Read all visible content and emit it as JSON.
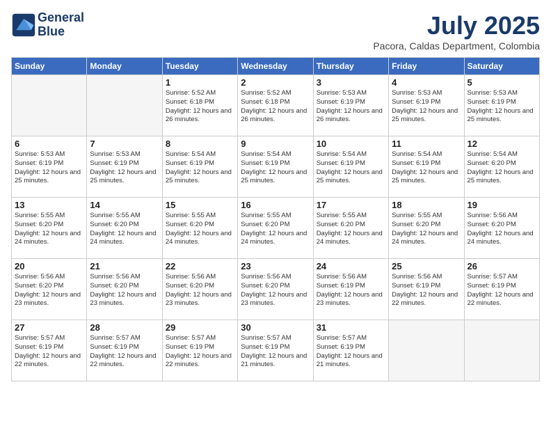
{
  "header": {
    "logo_line1": "General",
    "logo_line2": "Blue",
    "month": "July 2025",
    "location": "Pacora, Caldas Department, Colombia"
  },
  "days_of_week": [
    "Sunday",
    "Monday",
    "Tuesday",
    "Wednesday",
    "Thursday",
    "Friday",
    "Saturday"
  ],
  "weeks": [
    [
      {
        "day": "",
        "info": ""
      },
      {
        "day": "",
        "info": ""
      },
      {
        "day": "1",
        "info": "Sunrise: 5:52 AM\nSunset: 6:18 PM\nDaylight: 12 hours and 26 minutes."
      },
      {
        "day": "2",
        "info": "Sunrise: 5:52 AM\nSunset: 6:18 PM\nDaylight: 12 hours and 26 minutes."
      },
      {
        "day": "3",
        "info": "Sunrise: 5:53 AM\nSunset: 6:19 PM\nDaylight: 12 hours and 26 minutes."
      },
      {
        "day": "4",
        "info": "Sunrise: 5:53 AM\nSunset: 6:19 PM\nDaylight: 12 hours and 25 minutes."
      },
      {
        "day": "5",
        "info": "Sunrise: 5:53 AM\nSunset: 6:19 PM\nDaylight: 12 hours and 25 minutes."
      }
    ],
    [
      {
        "day": "6",
        "info": "Sunrise: 5:53 AM\nSunset: 6:19 PM\nDaylight: 12 hours and 25 minutes."
      },
      {
        "day": "7",
        "info": "Sunrise: 5:53 AM\nSunset: 6:19 PM\nDaylight: 12 hours and 25 minutes."
      },
      {
        "day": "8",
        "info": "Sunrise: 5:54 AM\nSunset: 6:19 PM\nDaylight: 12 hours and 25 minutes."
      },
      {
        "day": "9",
        "info": "Sunrise: 5:54 AM\nSunset: 6:19 PM\nDaylight: 12 hours and 25 minutes."
      },
      {
        "day": "10",
        "info": "Sunrise: 5:54 AM\nSunset: 6:19 PM\nDaylight: 12 hours and 25 minutes."
      },
      {
        "day": "11",
        "info": "Sunrise: 5:54 AM\nSunset: 6:19 PM\nDaylight: 12 hours and 25 minutes."
      },
      {
        "day": "12",
        "info": "Sunrise: 5:54 AM\nSunset: 6:20 PM\nDaylight: 12 hours and 25 minutes."
      }
    ],
    [
      {
        "day": "13",
        "info": "Sunrise: 5:55 AM\nSunset: 6:20 PM\nDaylight: 12 hours and 24 minutes."
      },
      {
        "day": "14",
        "info": "Sunrise: 5:55 AM\nSunset: 6:20 PM\nDaylight: 12 hours and 24 minutes."
      },
      {
        "day": "15",
        "info": "Sunrise: 5:55 AM\nSunset: 6:20 PM\nDaylight: 12 hours and 24 minutes."
      },
      {
        "day": "16",
        "info": "Sunrise: 5:55 AM\nSunset: 6:20 PM\nDaylight: 12 hours and 24 minutes."
      },
      {
        "day": "17",
        "info": "Sunrise: 5:55 AM\nSunset: 6:20 PM\nDaylight: 12 hours and 24 minutes."
      },
      {
        "day": "18",
        "info": "Sunrise: 5:55 AM\nSunset: 6:20 PM\nDaylight: 12 hours and 24 minutes."
      },
      {
        "day": "19",
        "info": "Sunrise: 5:56 AM\nSunset: 6:20 PM\nDaylight: 12 hours and 24 minutes."
      }
    ],
    [
      {
        "day": "20",
        "info": "Sunrise: 5:56 AM\nSunset: 6:20 PM\nDaylight: 12 hours and 23 minutes."
      },
      {
        "day": "21",
        "info": "Sunrise: 5:56 AM\nSunset: 6:20 PM\nDaylight: 12 hours and 23 minutes."
      },
      {
        "day": "22",
        "info": "Sunrise: 5:56 AM\nSunset: 6:20 PM\nDaylight: 12 hours and 23 minutes."
      },
      {
        "day": "23",
        "info": "Sunrise: 5:56 AM\nSunset: 6:20 PM\nDaylight: 12 hours and 23 minutes."
      },
      {
        "day": "24",
        "info": "Sunrise: 5:56 AM\nSunset: 6:19 PM\nDaylight: 12 hours and 23 minutes."
      },
      {
        "day": "25",
        "info": "Sunrise: 5:56 AM\nSunset: 6:19 PM\nDaylight: 12 hours and 22 minutes."
      },
      {
        "day": "26",
        "info": "Sunrise: 5:57 AM\nSunset: 6:19 PM\nDaylight: 12 hours and 22 minutes."
      }
    ],
    [
      {
        "day": "27",
        "info": "Sunrise: 5:57 AM\nSunset: 6:19 PM\nDaylight: 12 hours and 22 minutes."
      },
      {
        "day": "28",
        "info": "Sunrise: 5:57 AM\nSunset: 6:19 PM\nDaylight: 12 hours and 22 minutes."
      },
      {
        "day": "29",
        "info": "Sunrise: 5:57 AM\nSunset: 6:19 PM\nDaylight: 12 hours and 22 minutes."
      },
      {
        "day": "30",
        "info": "Sunrise: 5:57 AM\nSunset: 6:19 PM\nDaylight: 12 hours and 21 minutes."
      },
      {
        "day": "31",
        "info": "Sunrise: 5:57 AM\nSunset: 6:19 PM\nDaylight: 12 hours and 21 minutes."
      },
      {
        "day": "",
        "info": ""
      },
      {
        "day": "",
        "info": ""
      }
    ]
  ]
}
